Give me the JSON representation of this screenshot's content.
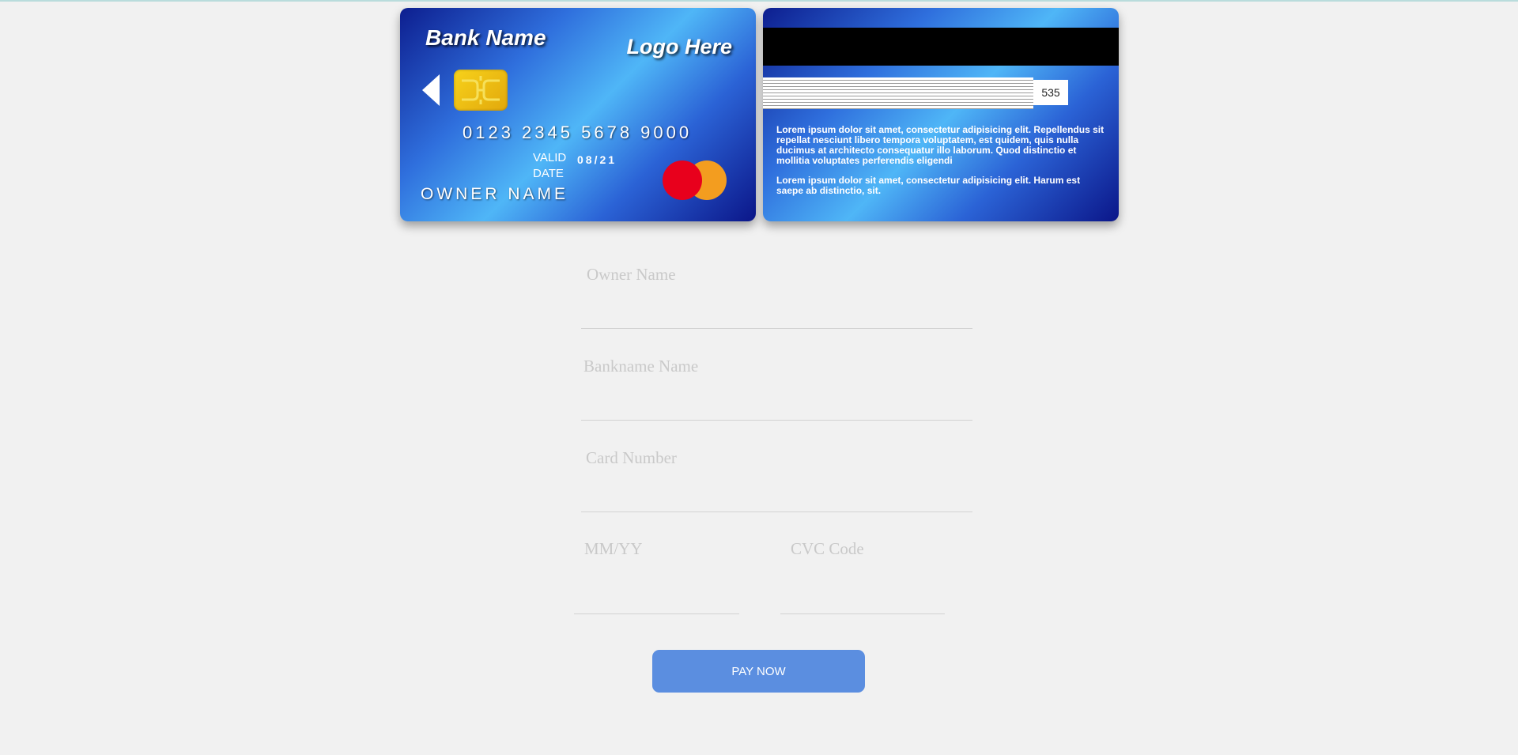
{
  "card_front": {
    "bank_name": "Bank Name",
    "logo_text": "Logo Here",
    "card_number": "0123 2345 5678 9000",
    "valid_label": "VALID DATE",
    "valid_date": "08/21",
    "owner_name": "OWNER NAME"
  },
  "card_back": {
    "cvc": "535",
    "text_1": "Lorem ipsum dolor sit amet, consectetur adipisicing elit. Repellendus sit repellat nesciunt libero tempora voluptatem, est quidem, quis nulla ducimus at architecto consequatur illo laborum. Quod distinctio et mollitia voluptates perferendis eligendi",
    "text_2": "Lorem ipsum dolor sit amet, consectetur adipisicing elit. Harum est saepe ab distinctio, sit."
  },
  "form": {
    "owner_placeholder": "Owner Name",
    "bank_placeholder": "Bankname Name",
    "card_number_placeholder": "Card Number",
    "expiry_placeholder": "MM/YY",
    "cvc_placeholder": "CVC Code",
    "pay_button": "PAY NOW"
  },
  "colors": {
    "page_background": "#f1f1f1",
    "button": "#5b8ee0",
    "card_dark_blue": "#0d1e8f",
    "card_light_blue": "#4fb6f7"
  }
}
